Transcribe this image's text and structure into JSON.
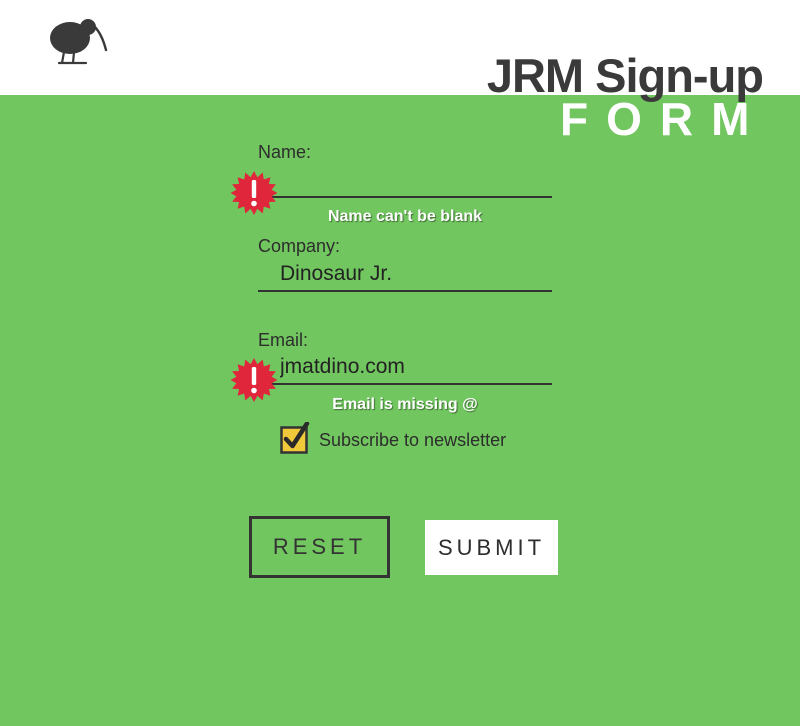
{
  "header": {
    "logo_icon": "kiwi-bird-icon",
    "title_line1": "JRM Sign-up",
    "title_line2": "FORM"
  },
  "form": {
    "name": {
      "label": "Name:",
      "value": "",
      "error": "Name can't be blank"
    },
    "company": {
      "label": "Company:",
      "value": "Dinosaur Jr."
    },
    "email": {
      "label": "Email:",
      "value": "jmatdino.com",
      "error": "Email is missing @"
    },
    "newsletter": {
      "label": "Subscribe to newsletter",
      "checked": true
    },
    "buttons": {
      "reset": "RESET",
      "submit": "SUBMIT"
    }
  },
  "colors": {
    "background": "#71c65f",
    "header": "#ffffff",
    "error_badge": "#e0263a",
    "checkbox_fill": "#f0c93a",
    "text_dark": "#2d2d2d"
  }
}
